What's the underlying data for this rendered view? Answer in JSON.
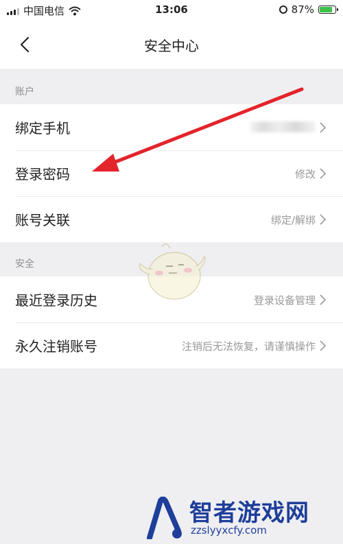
{
  "status_bar": {
    "carrier": "中国电信",
    "time": "13:06",
    "battery": "87%",
    "battery_level": 0.87
  },
  "nav": {
    "title": "安全中心",
    "back_icon": "chevron-left-icon"
  },
  "sections": [
    {
      "header": "账户",
      "rows": [
        {
          "label": "绑定手机",
          "value": ""
        },
        {
          "label": "登录密码",
          "value": "修改"
        },
        {
          "label": "账号关联",
          "value": "绑定/解绑"
        }
      ]
    },
    {
      "header": "安全",
      "rows": [
        {
          "label": "最近登录历史",
          "value": "登录设备管理"
        },
        {
          "label": "永久注销账号",
          "value": "注销后无法恢复，请谨慎操作"
        }
      ]
    }
  ],
  "watermark": {
    "title": "智者游戏网",
    "url": "zzslyyxcfy.com"
  },
  "colors": {
    "annotation_arrow": "#e3242b",
    "watermark": "#1f3e9a",
    "background": "#efeff2"
  }
}
